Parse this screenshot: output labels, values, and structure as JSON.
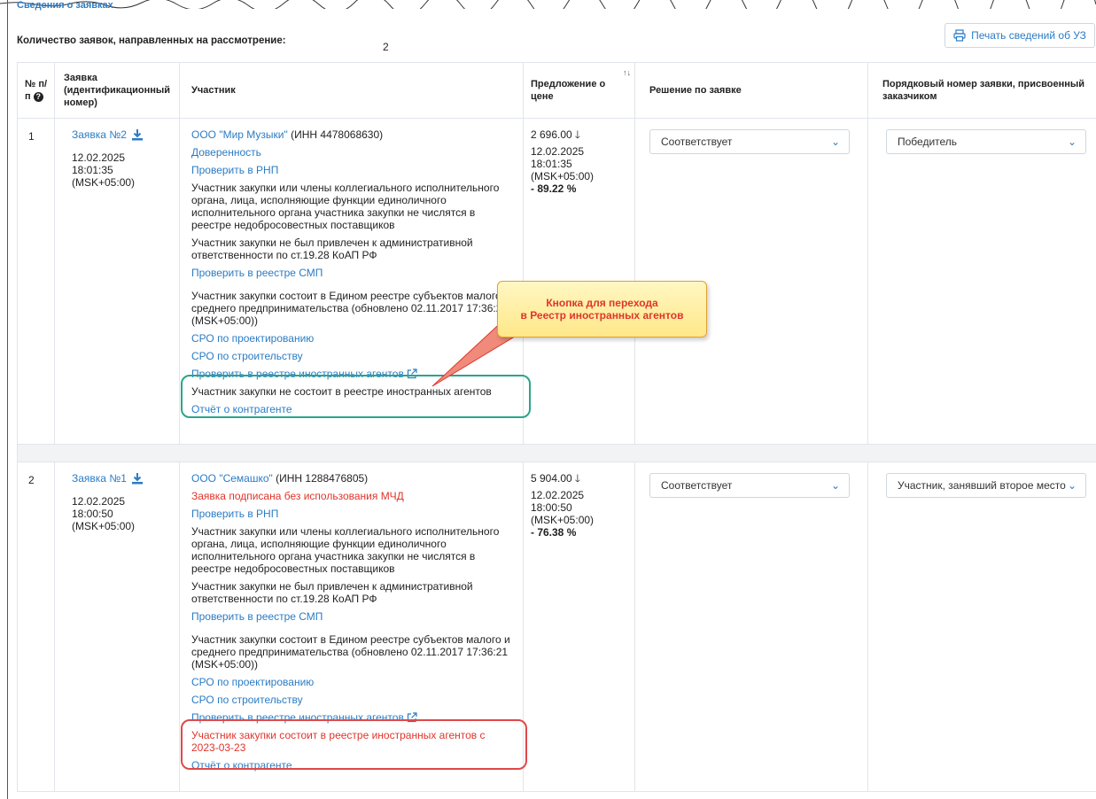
{
  "section_title": "Сведения о заявках",
  "count": {
    "label": "Количество заявок, направленных на рассмотрение:",
    "value": "2"
  },
  "print_button": {
    "label": "Печать сведений об УЗ",
    "icon": "printer-icon"
  },
  "headers": {
    "num": "№ п/п",
    "application": "Заявка (идентификационный номер)",
    "participant": "Участник",
    "price": "Предложение о цене",
    "decision": "Решение по заявке",
    "rank": "Порядковый номер заявки, присвоенный заказчиком"
  },
  "rows": [
    {
      "num": "1",
      "app_link": "Заявка №2",
      "app_date": "12.02.2025",
      "app_time": "18:01:35",
      "app_tz": "(MSK+05:00)",
      "participant_name": "ООО \"Мир Музыки\"",
      "participant_inn": " (ИНН 4478068630)",
      "line_power": "Доверенность",
      "check_rnp": "Проверить в РНП",
      "rnp_text": "Участник закупки или члены коллегиального исполнительного органа, лица, исполняющие функции единоличного исполнительного органа участника закупки не числятся в реестре недобросовестных поставщиков",
      "koap_text": "Участник закупки не был привлечен к административной ответственности по ст.19.28 КоАП РФ",
      "check_smp": "Проверить в реестре СМП",
      "smp_text": "Участник закупки состоит в Едином реестре субъектов малого и среднего предпринимательства (обновлено 02.11.2017 17:36:21 (MSK+05:00))",
      "sro_design": "СРО по проектированию",
      "sro_build": "СРО по строительству",
      "check_agents": "Проверить в реестре иностранных агентов",
      "agents_text": "Участник закупки не состоит в реестре иностранных агентов",
      "report": "Отчёт о контрагенте",
      "price": "2 696.00",
      "price_date": "12.02.2025",
      "price_time": "18:01:35",
      "price_tz": "(MSK+05:00)",
      "price_pct": "- 89.22 %",
      "decision": "Соответствует",
      "rank": "Победитель"
    },
    {
      "num": "2",
      "app_link": "Заявка №1",
      "app_date": "12.02.2025",
      "app_time": "18:00:50",
      "app_tz": "(MSK+05:00)",
      "participant_name": "ООО \"Семашко\"",
      "participant_inn": " (ИНН 1288476805)",
      "line_power": "Заявка подписана без использования МЧД",
      "check_rnp": "Проверить в РНП",
      "rnp_text": "Участник закупки или члены коллегиального исполнительного органа, лица, исполняющие функции единоличного исполнительного органа участника закупки не числятся в реестре недобросовестных поставщиков",
      "koap_text": "Участник закупки не был привлечен к административной ответственности по ст.19.28 КоАП РФ",
      "check_smp": "Проверить в реестре СМП",
      "smp_text": "Участник закупки состоит в Едином реестре субъектов малого и среднего предпринимательства (обновлено 02.11.2017 17:36:21 (MSK+05:00))",
      "sro_design": "СРО по проектированию",
      "sro_build": "СРО по строительству",
      "check_agents": "Проверить в реестре иностранных агентов",
      "agents_text": "Участник закупки состоит в реестре иностранных агентов с 2023-03-23",
      "report": "Отчёт о контрагенте",
      "price": "5 904.00",
      "price_date": "12.02.2025",
      "price_time": "18:00:50",
      "price_tz": "(MSK+05:00)",
      "price_pct": "- 76.38 %",
      "decision": "Соответствует",
      "rank": "Участник, занявший второе место"
    }
  ],
  "callout": {
    "line1": "Кнопка для перехода",
    "line2": "в Реестр иностранных агентов"
  },
  "colors": {
    "link": "#2b7cc4",
    "warning": "#e0352b",
    "highlight_ok": "#2aa58a",
    "highlight_bad": "#e04848"
  }
}
